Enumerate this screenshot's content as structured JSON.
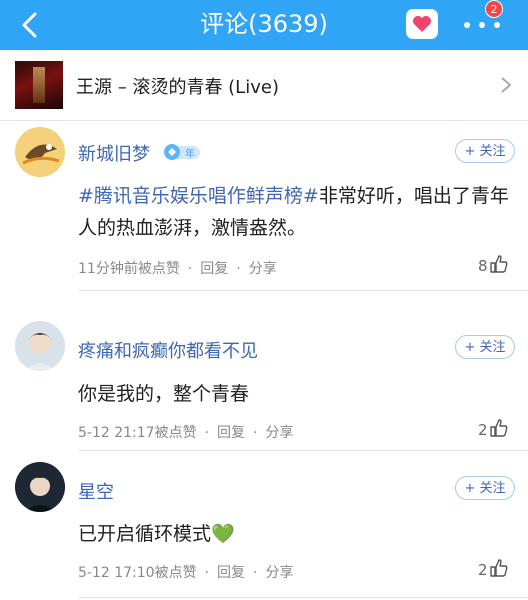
{
  "header": {
    "title": "评论(3639)",
    "badge_count": "2"
  },
  "song": {
    "title": "王源 – 滚烫的青春 (Live)"
  },
  "comments": [
    {
      "user": "新城旧梦",
      "vip_label": "年",
      "follow_label": "+ 关注",
      "tag": "#腾讯音乐娱乐唱作鲜声榜#",
      "text": "非常好听，唱出了青年人的热血澎湃，激情盎然。",
      "time": "11分钟前被点赞",
      "reply": "回复",
      "share": "分享",
      "likes": "8"
    },
    {
      "user": "疼痛和疯癫你都看不见",
      "follow_label": "+ 关注",
      "text": "你是我的，整个青春",
      "time": "5-12 21:17被点赞",
      "reply": "回复",
      "share": "分享",
      "likes": "2"
    },
    {
      "user": "星空",
      "follow_label": "+ 关注",
      "text": "已开启循环模式💚",
      "time": "5-12 17:10被点赞",
      "reply": "回复",
      "share": "分享",
      "likes": "2"
    }
  ],
  "colors": {
    "header": "#30a4f5",
    "link": "#3f67b3"
  }
}
